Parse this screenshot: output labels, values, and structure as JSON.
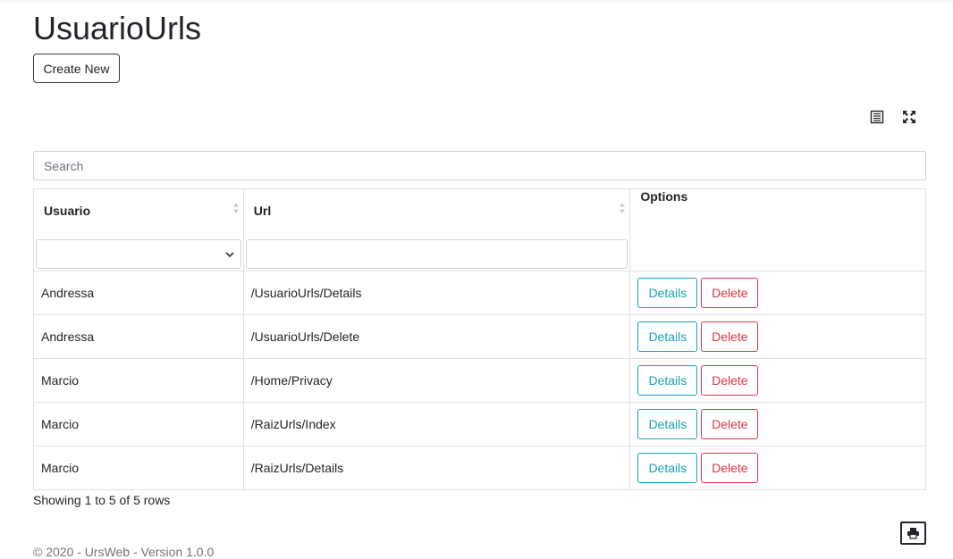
{
  "page": {
    "title": "UsuarioUrls",
    "create_label": "Create New"
  },
  "toolbar": {
    "columns_icon": "list-columns-icon",
    "fullscreen_icon": "fullscreen-icon"
  },
  "search": {
    "placeholder": "Search",
    "value": ""
  },
  "table": {
    "headers": {
      "usuario": "Usuario",
      "url": "Url",
      "options": "Options"
    },
    "filters": {
      "usuario_selected": "",
      "url_value": ""
    },
    "rows": [
      {
        "usuario": "Andressa",
        "url": "/UsuarioUrls/Details",
        "details": "Details",
        "delete": "Delete"
      },
      {
        "usuario": "Andressa",
        "url": "/UsuarioUrls/Delete",
        "details": "Details",
        "delete": "Delete"
      },
      {
        "usuario": "Marcio",
        "url": "/Home/Privacy",
        "details": "Details",
        "delete": "Delete"
      },
      {
        "usuario": "Marcio",
        "url": "/RaizUrls/Index",
        "details": "Details",
        "delete": "Delete"
      },
      {
        "usuario": "Marcio",
        "url": "/RaizUrls/Details",
        "details": "Details",
        "delete": "Delete"
      }
    ]
  },
  "pagination": {
    "summary": "Showing 1 to 5 of 5 rows"
  },
  "footer": {
    "print_icon": "print-icon",
    "copyright": "© 2020 - UrsWeb - Version 1.0.0"
  },
  "colors": {
    "details": "#17a2b8",
    "delete": "#dc3545",
    "border": "#dee2e6"
  }
}
